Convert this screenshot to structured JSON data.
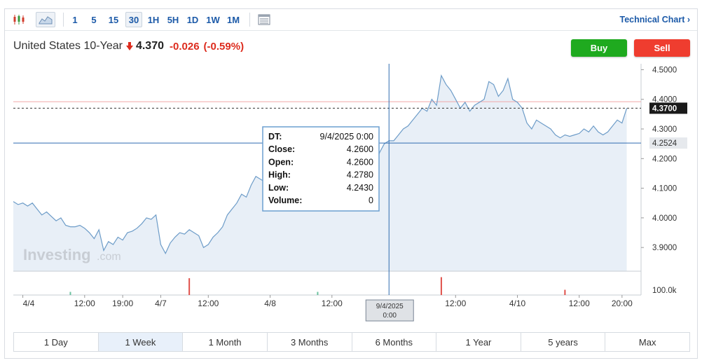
{
  "toolbar": {
    "chart_type_icons": [
      "candlestick-icon",
      "area-chart-icon"
    ],
    "intervals": [
      {
        "label": "1",
        "active": false
      },
      {
        "label": "5",
        "active": false
      },
      {
        "label": "15",
        "active": false
      },
      {
        "label": "30",
        "active": true
      },
      {
        "label": "1H",
        "active": false
      },
      {
        "label": "5H",
        "active": false
      },
      {
        "label": "1D",
        "active": false
      },
      {
        "label": "1W",
        "active": false
      },
      {
        "label": "1M",
        "active": false
      }
    ],
    "settings_icon": "table-icon",
    "technical_chart_label": "Technical Chart ›"
  },
  "header": {
    "instrument": "United States 10-Year",
    "direction_icon": "down-arrow-icon",
    "last": "4.370",
    "change": "-0.026",
    "change_pct": "(-0.59%)",
    "negative_color": "#dd2c1e"
  },
  "buttons": {
    "buy": "Buy",
    "sell": "Sell",
    "buy_color": "#1faa1f",
    "sell_color": "#ef3d2f"
  },
  "watermark": {
    "brand": "Investing",
    "suffix": ".com"
  },
  "chart_data": {
    "type": "area",
    "title": "",
    "xlabel": "",
    "ylabel": "",
    "ylim": [
      3.82,
      4.52
    ],
    "yticks": [
      {
        "value": 4.5,
        "label": "4.5000"
      },
      {
        "value": 4.4,
        "label": "4.4000"
      },
      {
        "value": 4.3,
        "label": "4.3000"
      },
      {
        "value": 4.2,
        "label": "4.2000"
      },
      {
        "value": 4.1,
        "label": "4.1000"
      },
      {
        "value": 4.0,
        "label": "4.0000"
      },
      {
        "value": 3.9,
        "label": "3.9000"
      }
    ],
    "xlim": [
      0,
      132
    ],
    "xticks": [
      {
        "x": 2,
        "label": "4/4"
      },
      {
        "x": 15,
        "label": "12:00"
      },
      {
        "x": 23,
        "label": "19:00"
      },
      {
        "x": 31,
        "label": "4/7"
      },
      {
        "x": 41,
        "label": "12:00"
      },
      {
        "x": 54,
        "label": "4/8"
      },
      {
        "x": 67,
        "label": "12:00"
      },
      {
        "x": 93,
        "label": "12:00"
      },
      {
        "x": 106,
        "label": "4/10"
      },
      {
        "x": 119,
        "label": "12:00"
      },
      {
        "x": 128,
        "label": "20:00"
      }
    ],
    "series": [
      {
        "x": [
          0,
          1,
          2,
          3,
          4,
          5,
          6,
          7,
          8,
          9,
          10,
          11,
          12,
          13,
          14,
          15,
          16,
          17,
          18,
          19,
          20,
          21,
          22,
          23,
          24,
          25,
          26,
          27,
          28,
          29,
          30,
          31,
          32,
          33,
          34,
          35,
          36,
          37,
          38,
          39,
          40,
          41,
          42,
          43,
          44,
          45,
          46,
          47,
          48,
          49,
          50,
          51,
          52,
          53,
          54,
          55,
          56,
          57,
          58,
          59,
          60,
          61,
          62,
          63,
          64,
          65,
          66,
          67,
          68,
          69,
          70,
          71,
          72,
          73,
          74,
          75,
          76,
          77,
          78,
          79,
          80,
          81,
          82,
          83,
          84,
          85,
          86,
          87,
          88,
          89,
          90,
          91,
          92,
          93,
          94,
          95,
          96,
          97,
          98,
          99,
          100,
          101,
          102,
          103,
          104,
          105,
          106,
          107,
          108,
          109,
          110,
          111,
          112,
          113,
          114,
          115,
          116,
          117,
          118,
          119,
          120,
          121,
          122,
          123,
          124,
          125,
          126,
          127,
          128,
          129
        ],
        "values": [
          4.055,
          4.045,
          4.05,
          4.04,
          4.05,
          4.03,
          4.01,
          4.02,
          4.005,
          3.99,
          4.0,
          3.975,
          3.97,
          3.97,
          3.975,
          3.965,
          3.95,
          3.93,
          3.96,
          3.89,
          3.92,
          3.91,
          3.935,
          3.925,
          3.95,
          3.955,
          3.965,
          3.98,
          4.0,
          3.995,
          4.01,
          3.91,
          3.88,
          3.915,
          3.935,
          3.95,
          3.945,
          3.96,
          3.95,
          3.94,
          3.9,
          3.91,
          3.935,
          3.95,
          3.97,
          4.01,
          4.03,
          4.05,
          4.08,
          4.07,
          4.11,
          4.14,
          4.13,
          4.12,
          4.15,
          4.13,
          4.16,
          4.14,
          4.17,
          4.15,
          4.15,
          4.16,
          4.14,
          4.15,
          4.155,
          4.14,
          4.16,
          4.15,
          4.17,
          4.17,
          4.15,
          4.16,
          4.14,
          4.17,
          4.155,
          4.16,
          4.17,
          4.22,
          4.25,
          4.26,
          4.26,
          4.28,
          4.3,
          4.31,
          4.33,
          4.35,
          4.37,
          4.36,
          4.4,
          4.38,
          4.48,
          4.45,
          4.43,
          4.4,
          4.37,
          4.39,
          4.36,
          4.38,
          4.39,
          4.4,
          4.46,
          4.45,
          4.41,
          4.43,
          4.47,
          4.4,
          4.39,
          4.37,
          4.32,
          4.3,
          4.33,
          4.32,
          4.31,
          4.3,
          4.28,
          4.27,
          4.28,
          4.275,
          4.28,
          4.285,
          4.3,
          4.29,
          4.31,
          4.29,
          4.28,
          4.29,
          4.31,
          4.33,
          4.32,
          4.37
        ]
      }
    ],
    "volume": {
      "axis_label": "100.0k",
      "bars": [
        {
          "x": 12,
          "value": 0.15
        },
        {
          "x": 37,
          "value": 0.8
        },
        {
          "x": 64,
          "value": 0.15
        },
        {
          "x": 90,
          "value": 0.85
        },
        {
          "x": 116,
          "value": 0.25
        }
      ]
    },
    "last_price_line": {
      "value": 4.37,
      "label": "4.3700"
    },
    "prev_close_line": {
      "value": 4.392
    },
    "crosshair": {
      "x": 79,
      "value": 4.2524,
      "price_label": "4.2524",
      "date_label": [
        "9/4/2025",
        "0:00"
      ]
    },
    "tooltip": [
      {
        "key": "DT:",
        "value": "9/4/2025 0:00"
      },
      {
        "key": "Close:",
        "value": "4.2600"
      },
      {
        "key": "Open:",
        "value": "4.2600"
      },
      {
        "key": "High:",
        "value": "4.2780"
      },
      {
        "key": "Low:",
        "value": "4.2430"
      },
      {
        "key": "Volume:",
        "value": "0"
      }
    ],
    "colors": {
      "line": "#6d9cc8",
      "fill": "#e8eff7",
      "crosshair": "#2f6bb0",
      "last_price_tag": "#1a1a1a",
      "prev_close": "#f1a9a9"
    }
  },
  "ranges": [
    {
      "label": "1 Day",
      "active": false
    },
    {
      "label": "1 Week",
      "active": true
    },
    {
      "label": "1 Month",
      "active": false
    },
    {
      "label": "3 Months",
      "active": false
    },
    {
      "label": "6 Months",
      "active": false
    },
    {
      "label": "1 Year",
      "active": false
    },
    {
      "label": "5 years",
      "active": false
    },
    {
      "label": "Max",
      "active": false
    }
  ]
}
